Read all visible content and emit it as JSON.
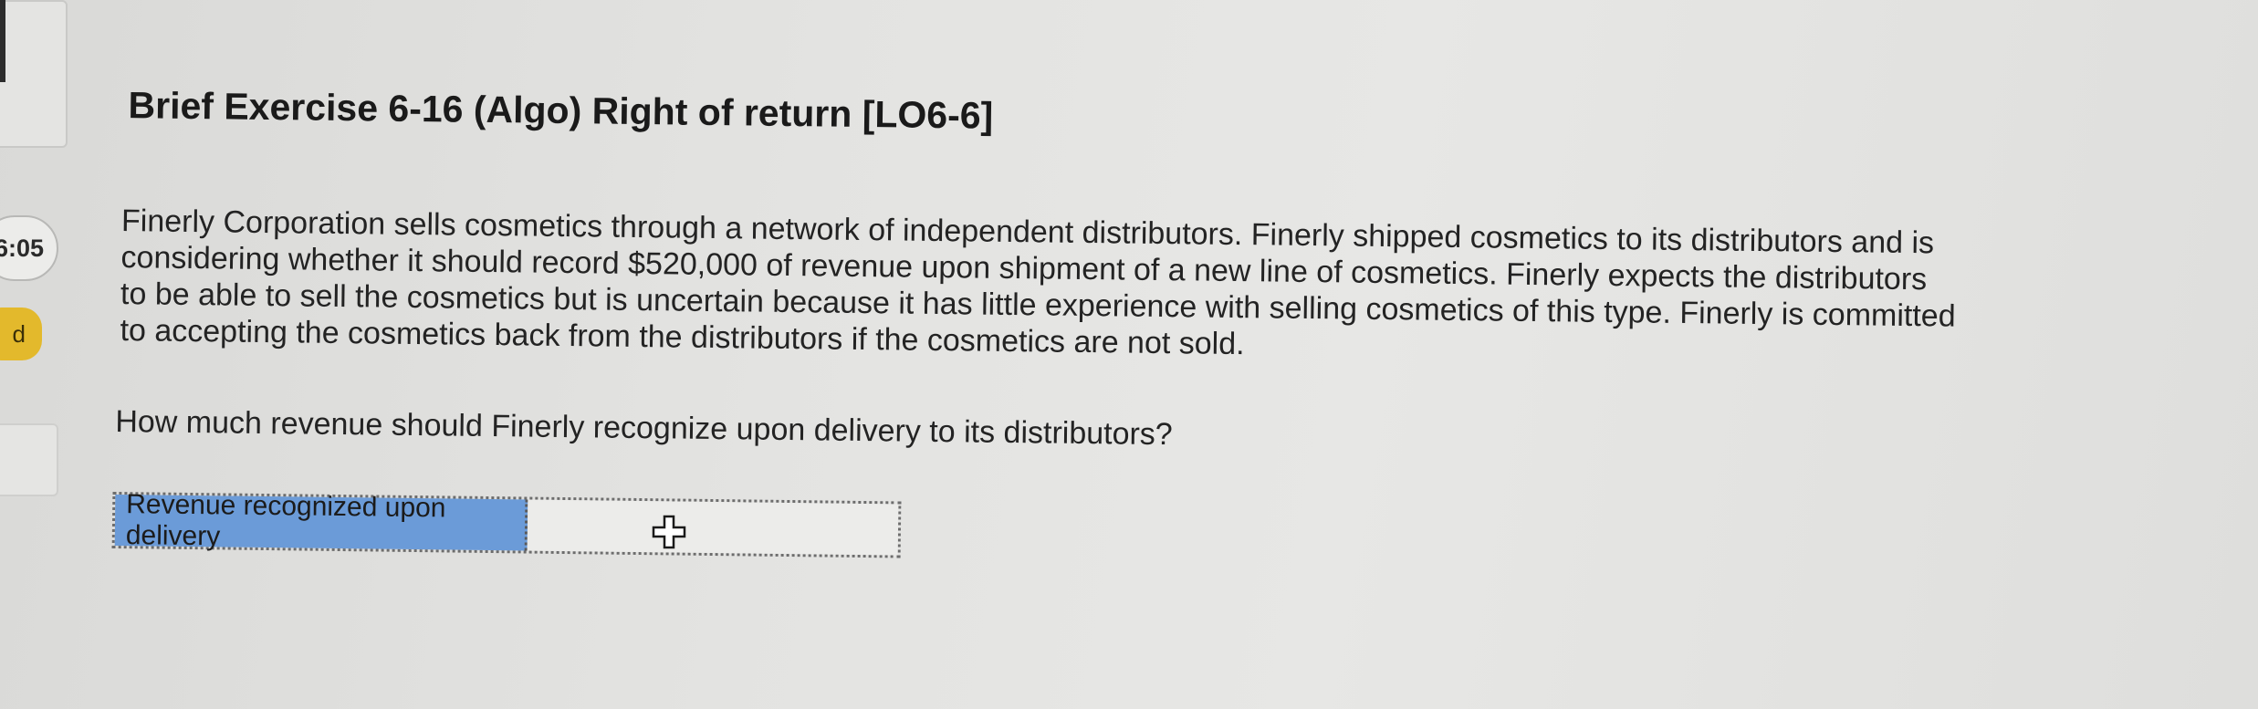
{
  "sidebar": {
    "timer": "6:05",
    "badge": "d"
  },
  "exercise": {
    "title": "Brief Exercise 6-16 (Algo) Right of return [LO6-6]",
    "paragraph_lines": [
      "Finerly Corporation sells cosmetics through a network of independent distributors. Finerly shipped cosmetics to its distributors and is",
      "considering whether it should record $520,000 of revenue upon shipment of a new line of cosmetics. Finerly expects the distributors",
      "to be able to sell the cosmetics but is uncertain because it has little experience with selling cosmetics of this type. Finerly is committed",
      "to accepting the cosmetics back from the distributors if the cosmetics are not sold."
    ],
    "question": "How much revenue should Finerly recognize upon delivery to its distributors?"
  },
  "answer_table": {
    "label": "Revenue recognized upon delivery",
    "value": ""
  },
  "icons": {
    "cursor": "move-cursor-icon"
  }
}
